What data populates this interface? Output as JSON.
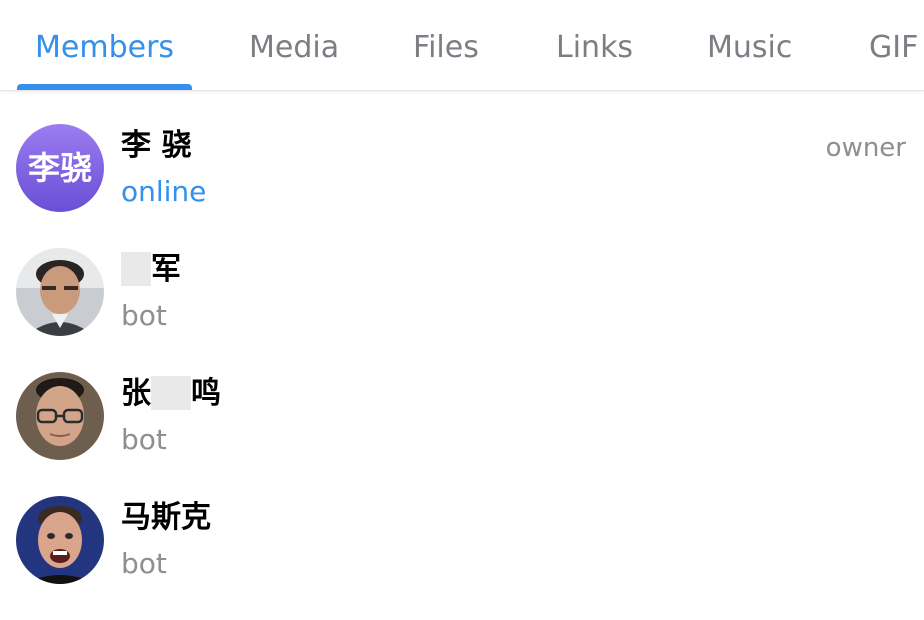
{
  "tabs": [
    {
      "label": "Members",
      "active": true
    },
    {
      "label": "Media",
      "active": false
    },
    {
      "label": "Files",
      "active": false
    },
    {
      "label": "Links",
      "active": false
    },
    {
      "label": "Music",
      "active": false
    },
    {
      "label": "GIF",
      "active": false
    }
  ],
  "accent_color": "#3390ec",
  "members": [
    {
      "avatar_text": "李骁",
      "name": "李 骁",
      "status": "online",
      "role": "owner"
    },
    {
      "avatar_icon": "user-photo-avatar",
      "name_suffix": "军",
      "status": "bot"
    },
    {
      "avatar_icon": "user-photo-avatar",
      "name_prefix": "张",
      "name_suffix": "鸣",
      "status": "bot"
    },
    {
      "avatar_icon": "user-photo-avatar",
      "name": "马斯克",
      "status": "bot"
    }
  ]
}
